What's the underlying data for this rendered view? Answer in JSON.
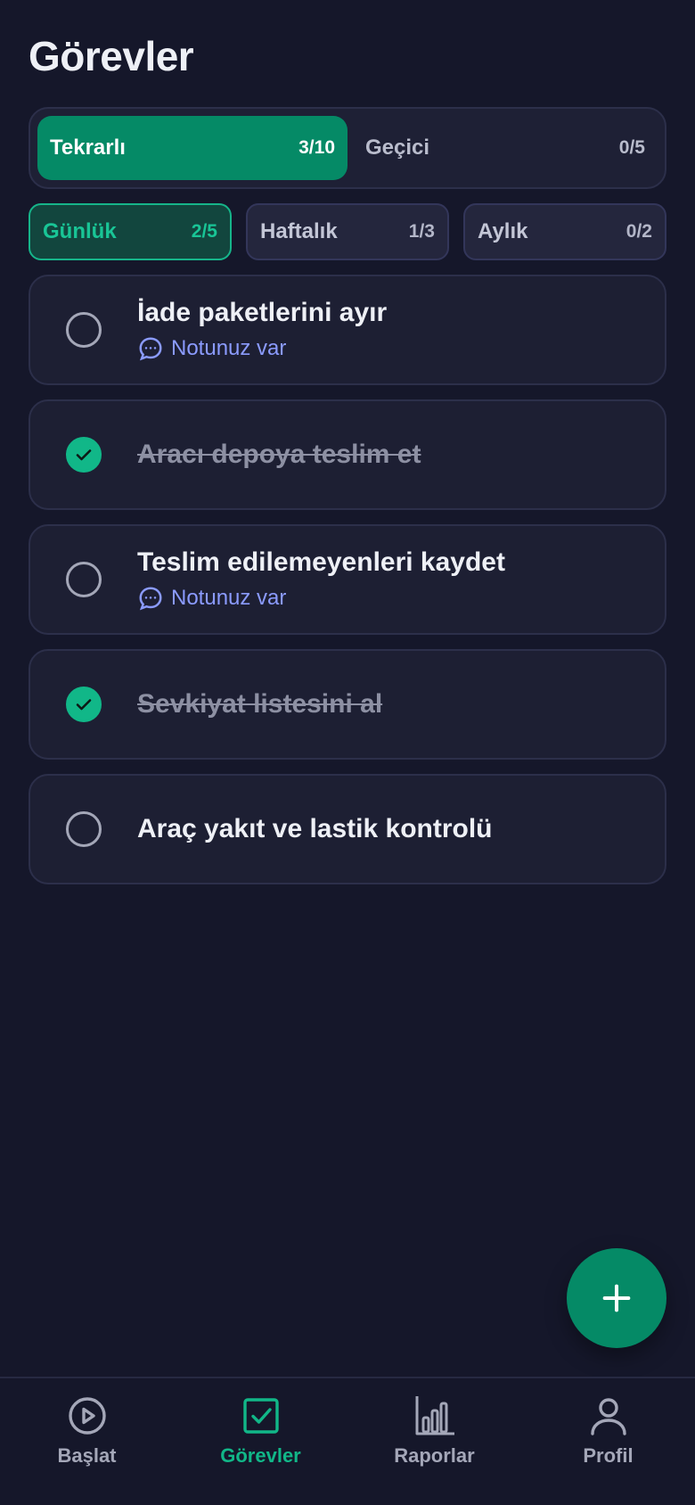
{
  "header": {
    "title": "Görevler"
  },
  "segments": [
    {
      "label": "Tekrarlı",
      "count": "3/10",
      "active": true
    },
    {
      "label": "Geçici",
      "count": "0/5",
      "active": false
    }
  ],
  "periods": [
    {
      "label": "Günlük",
      "count": "2/5",
      "active": true
    },
    {
      "label": "Haftalık",
      "count": "1/3",
      "active": false
    },
    {
      "label": "Aylık",
      "count": "0/2",
      "active": false
    }
  ],
  "tasks": [
    {
      "title": "İade paketlerini ayır",
      "done": false,
      "note": "Notunuz var"
    },
    {
      "title": "Aracı depoya teslim et",
      "done": true
    },
    {
      "title": "Teslim edilemeyenleri kaydet",
      "done": false,
      "note": "Notunuz var"
    },
    {
      "title": "Sevkiyat listesini al",
      "done": true
    },
    {
      "title": "Araç yakıt ve lastik kontrolü",
      "done": false
    }
  ],
  "fab": {
    "icon": "plus-icon"
  },
  "nav": [
    {
      "label": "Başlat",
      "icon": "play-circle-icon",
      "active": false
    },
    {
      "label": "Görevler",
      "icon": "checkbox-icon",
      "active": true
    },
    {
      "label": "Raporlar",
      "icon": "bar-chart-icon",
      "active": false
    },
    {
      "label": "Profil",
      "icon": "user-icon",
      "active": false
    }
  ],
  "colors": {
    "background": "#15172a",
    "accent": "#058a66",
    "success": "#11b788",
    "note": "#8b9bff"
  }
}
